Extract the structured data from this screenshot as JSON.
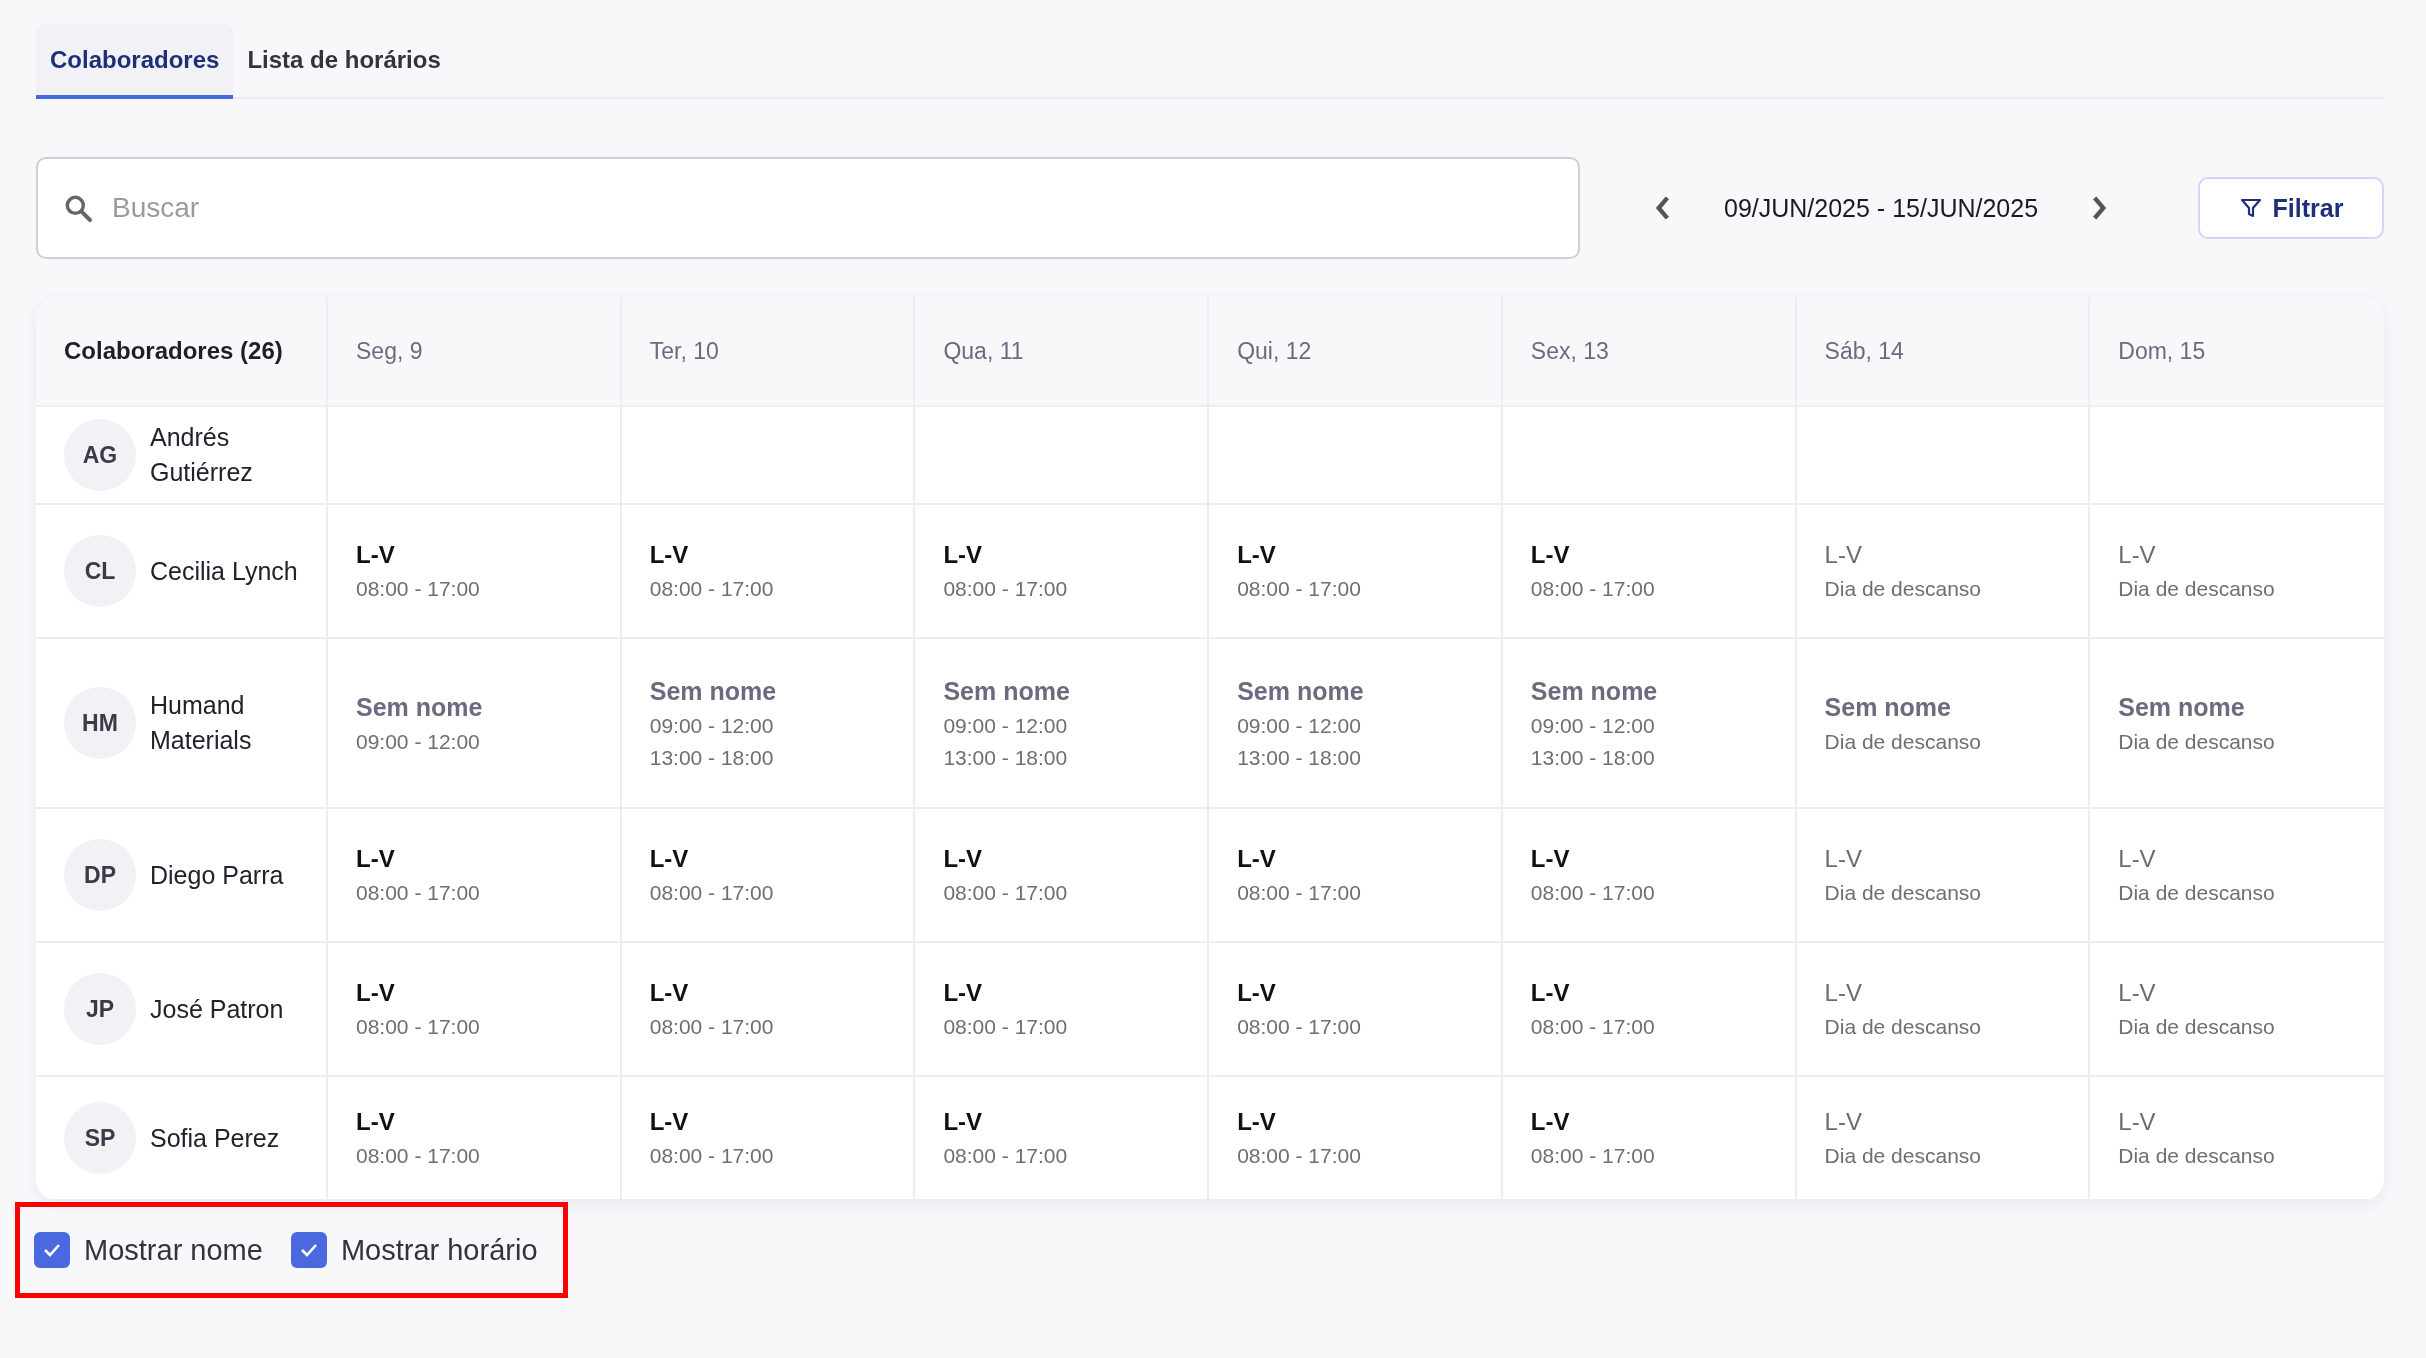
{
  "tabs": [
    {
      "label": "Colaboradores",
      "selected": true
    },
    {
      "label": "Lista de horários",
      "selected": false
    }
  ],
  "search": {
    "placeholder": "Buscar"
  },
  "date_range": "09/JUN/2025 - 15/JUN/2025",
  "filter_button": "Filtrar",
  "table": {
    "first_column": "Colaboradores (26)",
    "days": [
      "Seg, 9",
      "Ter, 10",
      "Qua, 11",
      "Qui, 12",
      "Sex, 13",
      "Sáb, 14",
      "Dom, 15"
    ],
    "rows": [
      {
        "initials": "AG",
        "name": "Andrés Gutiérrez"
      },
      {
        "initials": "CL",
        "name": "Cecilia Lynch",
        "cells": [
          {
            "kind": "work",
            "title": "L-V",
            "lines": [
              "08:00 - 17:00"
            ]
          },
          {
            "kind": "work",
            "title": "L-V",
            "lines": [
              "08:00 - 17:00"
            ]
          },
          {
            "kind": "work",
            "title": "L-V",
            "lines": [
              "08:00 - 17:00"
            ]
          },
          {
            "kind": "work",
            "title": "L-V",
            "lines": [
              "08:00 - 17:00"
            ]
          },
          {
            "kind": "work",
            "title": "L-V",
            "lines": [
              "08:00 - 17:00"
            ]
          },
          {
            "kind": "rest",
            "title": "L-V",
            "lines": [
              "Dia de descanso"
            ]
          },
          {
            "kind": "rest",
            "title": "L-V",
            "lines": [
              "Dia de descanso"
            ]
          }
        ]
      },
      {
        "initials": "HM",
        "name": "Humand Materials",
        "cells": [
          {
            "kind": "unnamed",
            "title": "Sem nome",
            "lines": [
              "09:00 - 12:00"
            ]
          },
          {
            "kind": "unnamed",
            "title": "Sem nome",
            "lines": [
              "09:00 - 12:00",
              "13:00 - 18:00"
            ]
          },
          {
            "kind": "unnamed",
            "title": "Sem nome",
            "lines": [
              "09:00 - 12:00",
              "13:00 - 18:00"
            ]
          },
          {
            "kind": "unnamed",
            "title": "Sem nome",
            "lines": [
              "09:00 - 12:00",
              "13:00 - 18:00"
            ]
          },
          {
            "kind": "unnamed",
            "title": "Sem nome",
            "lines": [
              "09:00 - 12:00",
              "13:00 - 18:00"
            ]
          },
          {
            "kind": "unnamed",
            "title": "Sem nome",
            "lines": [
              "Dia de descanso"
            ]
          },
          {
            "kind": "unnamed",
            "title": "Sem nome",
            "lines": [
              "Dia de descanso"
            ]
          }
        ]
      },
      {
        "initials": "DP",
        "name": "Diego Parra",
        "cells": [
          {
            "kind": "work",
            "title": "L-V",
            "lines": [
              "08:00 - 17:00"
            ]
          },
          {
            "kind": "work",
            "title": "L-V",
            "lines": [
              "08:00 - 17:00"
            ]
          },
          {
            "kind": "work",
            "title": "L-V",
            "lines": [
              "08:00 - 17:00"
            ]
          },
          {
            "kind": "work",
            "title": "L-V",
            "lines": [
              "08:00 - 17:00"
            ]
          },
          {
            "kind": "work",
            "title": "L-V",
            "lines": [
              "08:00 - 17:00"
            ]
          },
          {
            "kind": "rest",
            "title": "L-V",
            "lines": [
              "Dia de descanso"
            ]
          },
          {
            "kind": "rest",
            "title": "L-V",
            "lines": [
              "Dia de descanso"
            ]
          }
        ]
      },
      {
        "initials": "JP",
        "name": "José Patron",
        "cells": [
          {
            "kind": "work",
            "title": "L-V",
            "lines": [
              "08:00 - 17:00"
            ]
          },
          {
            "kind": "work",
            "title": "L-V",
            "lines": [
              "08:00 - 17:00"
            ]
          },
          {
            "kind": "work",
            "title": "L-V",
            "lines": [
              "08:00 - 17:00"
            ]
          },
          {
            "kind": "work",
            "title": "L-V",
            "lines": [
              "08:00 - 17:00"
            ]
          },
          {
            "kind": "work",
            "title": "L-V",
            "lines": [
              "08:00 - 17:00"
            ]
          },
          {
            "kind": "rest",
            "title": "L-V",
            "lines": [
              "Dia de descanso"
            ]
          },
          {
            "kind": "rest",
            "title": "L-V",
            "lines": [
              "Dia de descanso"
            ]
          }
        ]
      },
      {
        "initials": "SP",
        "name": "Sofia Perez",
        "cells": [
          {
            "kind": "work",
            "title": "L-V",
            "lines": [
              "08:00 - 17:00"
            ]
          },
          {
            "kind": "work",
            "title": "L-V",
            "lines": [
              "08:00 - 17:00"
            ]
          },
          {
            "kind": "work",
            "title": "L-V",
            "lines": [
              "08:00 - 17:00"
            ]
          },
          {
            "kind": "work",
            "title": "L-V",
            "lines": [
              "08:00 - 17:00"
            ]
          },
          {
            "kind": "work",
            "title": "L-V",
            "lines": [
              "08:00 - 17:00"
            ]
          },
          {
            "kind": "rest",
            "title": "L-V",
            "lines": [
              "Dia de descanso"
            ]
          },
          {
            "kind": "rest",
            "title": "L-V",
            "lines": [
              "Dia de descanso"
            ]
          }
        ]
      }
    ]
  },
  "options": [
    {
      "label": "Mostrar nome",
      "checked": true
    },
    {
      "label": "Mostrar horário",
      "checked": true
    }
  ]
}
